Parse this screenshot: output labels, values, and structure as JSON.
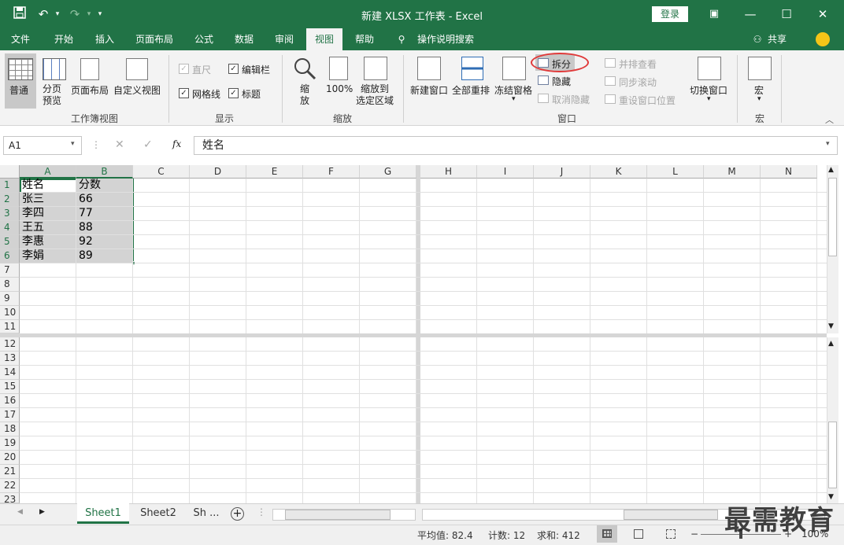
{
  "app": {
    "title": "新建 XLSX 工作表  -  Excel",
    "login_label": "登录"
  },
  "tabs": [
    {
      "label": "文件"
    },
    {
      "label": "开始"
    },
    {
      "label": "插入"
    },
    {
      "label": "页面布局"
    },
    {
      "label": "公式"
    },
    {
      "label": "数据"
    },
    {
      "label": "审阅"
    },
    {
      "label": "视图"
    },
    {
      "label": "帮助"
    },
    {
      "label": "操作说明搜索"
    }
  ],
  "share_label": "共享",
  "ribbon": {
    "workbook_views": {
      "group": "工作簿视图",
      "normal": "普通",
      "page_break": "分页\n预览",
      "page_layout": "页面布局",
      "custom": "自定义视图"
    },
    "show": {
      "group": "显示",
      "ruler": "直尺",
      "formula_bar": "编辑栏",
      "gridlines": "网格线",
      "headings": "标题"
    },
    "zoom": {
      "group": "缩放",
      "zoom": "缩\n放",
      "zoom100": "100%",
      "zoom_sel": "缩放到\n选定区域"
    },
    "window": {
      "group": "窗口",
      "new_window": "新建窗口",
      "arrange_all": "全部重排",
      "freeze": "冻结窗格",
      "split": "拆分",
      "hide": "隐藏",
      "unhide": "取消隐藏",
      "side_by_side": "并排查看",
      "sync_scroll": "同步滚动",
      "reset_pos": "重设窗口位置",
      "switch": "切换窗口"
    },
    "macro": {
      "group": "宏",
      "macro": "宏"
    }
  },
  "formula_bar": {
    "name_box": "A1",
    "fx": "fx",
    "value": "姓名"
  },
  "columns": [
    "A",
    "B",
    "C",
    "D",
    "E",
    "F",
    "G",
    "H",
    "I",
    "J",
    "K",
    "L",
    "M",
    "N"
  ],
  "rows_top": [
    "1",
    "2",
    "3",
    "4",
    "5",
    "6",
    "7",
    "8",
    "9",
    "10",
    "11"
  ],
  "rows_bottom": [
    "12",
    "13",
    "14",
    "15",
    "16",
    "17",
    "18",
    "19",
    "20",
    "21",
    "22",
    "23"
  ],
  "cells": [
    [
      "姓名",
      "分数"
    ],
    [
      "张三",
      "66"
    ],
    [
      "李四",
      "77"
    ],
    [
      "王五",
      "88"
    ],
    [
      "李惠",
      "92"
    ],
    [
      "李娟",
      "89"
    ]
  ],
  "sheets": [
    {
      "label": "Sheet1"
    },
    {
      "label": "Sheet2"
    },
    {
      "label": "Sh ..."
    }
  ],
  "status": {
    "average": "平均值: 82.4",
    "count": "计数: 12",
    "sum": "求和: 412",
    "zoom": "100%"
  },
  "watermark": "最需教育"
}
